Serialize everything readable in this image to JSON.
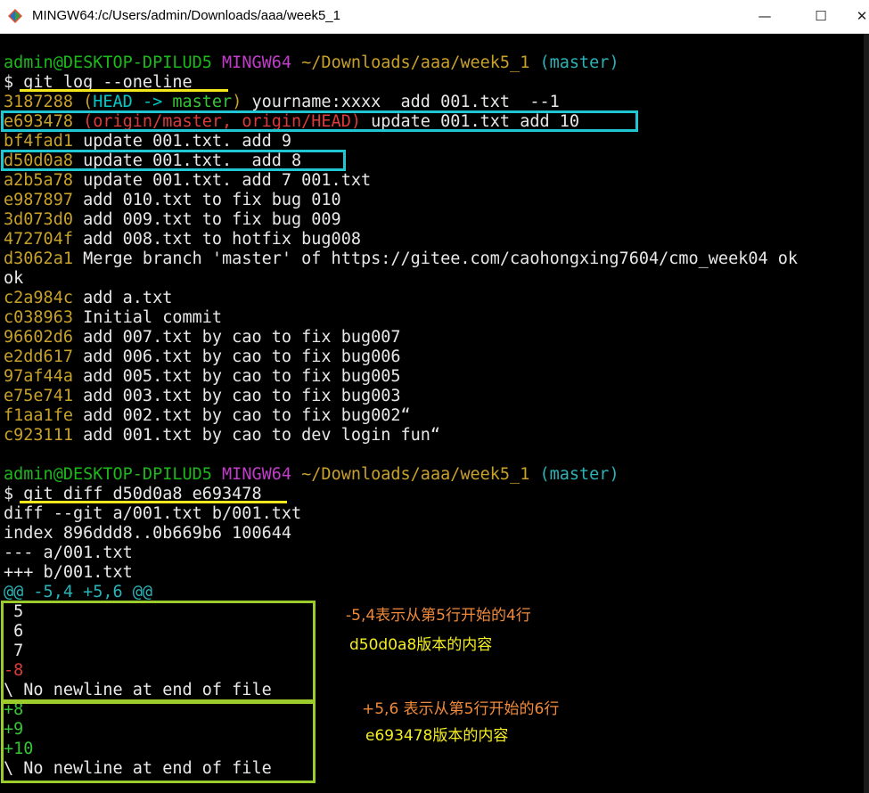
{
  "window": {
    "title": "MINGW64:/c/Users/admin/Downloads/aaa/week5_1",
    "minimize": "—",
    "maximize": "☐",
    "close": "✕"
  },
  "prompts": [
    {
      "user": "admin@DESKTOP-DPILUD5",
      "shell": "MINGW64",
      "path": "~/Downloads/aaa/week5_1",
      "branch": "(master)",
      "command": "$ git log --oneline"
    },
    {
      "user": "admin@DESKTOP-DPILUD5",
      "shell": "MINGW64",
      "path": "~/Downloads/aaa/week5_1",
      "branch": "(master)",
      "command": "$ git diff d50d0a8 e693478"
    }
  ],
  "log": {
    "first": {
      "hash": "3187288",
      "open": "(",
      "head": "HEAD -> ",
      "branch": "master",
      "close": ")",
      "msg": " yourname:xxxx  add 001.txt  --1"
    },
    "second": {
      "hash": "e693478",
      "refs": "(origin/master, origin/HEAD)",
      "msg": " update 001.txt add 10"
    },
    "rest": [
      {
        "hash": "bf4fad1",
        "msg": " update 001.txt. add 9"
      },
      {
        "hash": "d50d0a8",
        "msg": " update 001.txt.  add 8"
      },
      {
        "hash": "a2b5a78",
        "msg": " update 001.txt. add 7 001.txt"
      },
      {
        "hash": "e987897",
        "msg": " add 010.txt to fix bug 010"
      },
      {
        "hash": "3d073d0",
        "msg": " add 009.txt to fix bug 009"
      },
      {
        "hash": "472704f",
        "msg": " add 008.txt to hotfix bug008"
      },
      {
        "hash": "d3062a1",
        "msg": " Merge branch 'master' of https://gitee.com/caohongxing7604/cmo_week04 ok"
      },
      {
        "hash": "",
        "msg": "ok"
      },
      {
        "hash": "c2a984c",
        "msg": " add a.txt"
      },
      {
        "hash": "c038963",
        "msg": " Initial commit"
      },
      {
        "hash": "96602d6",
        "msg": " add 007.txt by cao to fix bug007"
      },
      {
        "hash": "e2dd617",
        "msg": " add 006.txt by cao to fix bug006"
      },
      {
        "hash": "97af44a",
        "msg": " add 005.txt by cao to fix bug005"
      },
      {
        "hash": "e75e741",
        "msg": " add 003.txt by cao to fix bug003"
      },
      {
        "hash": "f1aa1fe",
        "msg": " add 002.txt by cao to fix bug002“"
      },
      {
        "hash": "c923111",
        "msg": " add 001.txt by cao to dev login fun“"
      }
    ]
  },
  "diff": {
    "header": [
      "diff --git a/001.txt b/001.txt",
      "index 896ddd8..0b669b6 100644",
      "--- a/001.txt",
      "+++ b/001.txt"
    ],
    "hunk": "@@ -5,4 +5,6 @@",
    "context": [
      " 5",
      " 6",
      " 7"
    ],
    "removed": "-8",
    "no_newline": "\\ No newline at end of file",
    "added": [
      "+8",
      "+9",
      "+10"
    ],
    "no_newline2": "\\ No newline at end of file"
  },
  "annotations": {
    "old_range": "-5,4表示从第5行开始的4行",
    "old_version": "d50d0a8版本的内容",
    "new_range": "+5,6 表示从第5行开始的6行",
    "new_version": "e693478版本的内容"
  }
}
